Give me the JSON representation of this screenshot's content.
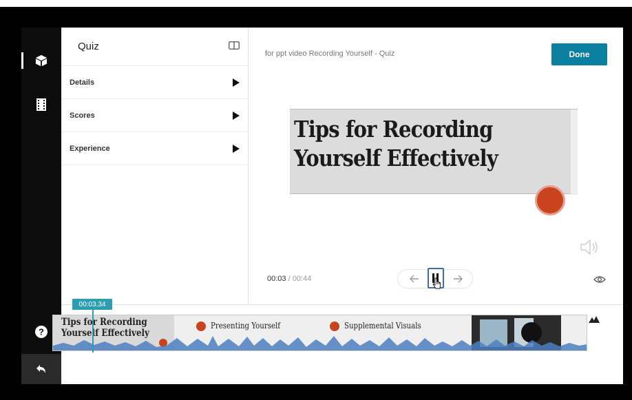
{
  "rail": {
    "items": [
      {
        "icon": "cube-icon",
        "active": true
      },
      {
        "icon": "film-icon",
        "active": false
      }
    ],
    "help_icon": "help-icon",
    "back_icon": "back-arrow-icon"
  },
  "panel": {
    "title": "Quiz",
    "layout_icon": "panel-toggle-icon",
    "sections": [
      {
        "label": "Details"
      },
      {
        "label": "Scores"
      },
      {
        "label": "Experience"
      }
    ]
  },
  "preview": {
    "video_title": "for ppt video Recording Yourself - Quiz",
    "done_label": "Done",
    "slide_line1": "Tips for Recording",
    "slide_line2": "Yourself Effectively",
    "current_time": "00:03",
    "separator": "/",
    "total_time": "00:44",
    "prev_icon": "arrow-left-icon",
    "next_icon": "arrow-right-icon",
    "pause_icon": "pause-icon",
    "volume_icon": "volume-icon",
    "eye_icon": "eye-icon"
  },
  "timeline": {
    "playhead_time": "00:03.34",
    "waveform_icon": "waveform-icon",
    "zoom_level": 0.05,
    "thumb_line1": "Tips for Recording",
    "thumb_line2": "Yourself Effectively",
    "markers": [
      {
        "label": "Presenting Yourself"
      },
      {
        "label": "Supplemental Visuals"
      }
    ]
  },
  "colors": {
    "accent": "#0b7f9f",
    "playhead": "#2c9db3",
    "marker": "#c9431e",
    "rail": "#0c0c0c"
  }
}
